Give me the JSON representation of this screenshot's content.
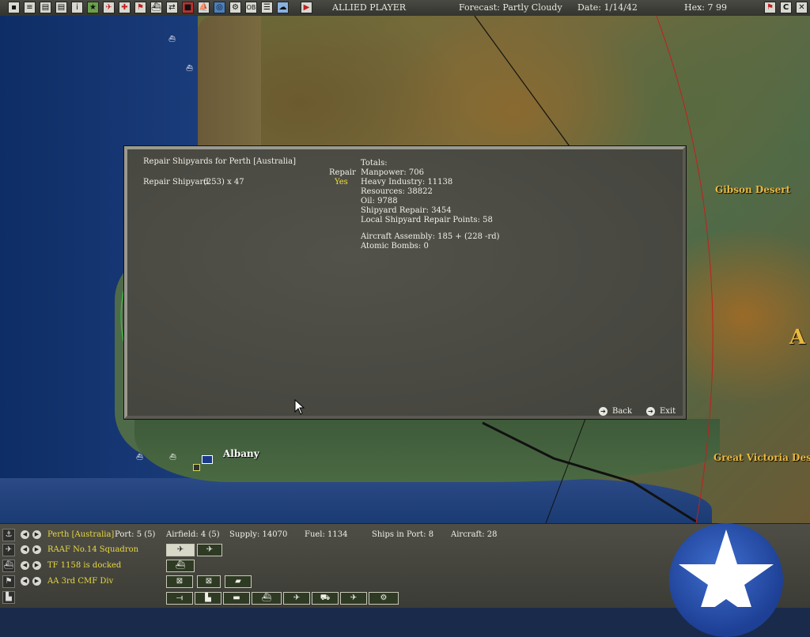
{
  "topbar": {
    "player": "ALLIED PLAYER",
    "forecast": "Forecast: Partly Cloudy",
    "date": "Date: 1/14/42",
    "hex": "Hex: 7 99",
    "buttons_left": [
      "doc",
      "doc",
      "doc",
      "doc",
      "info",
      "star",
      "plane",
      "plane",
      "flag",
      "ship",
      "ship",
      "flag",
      "ship",
      "globe",
      "sub",
      "OB",
      "list",
      "cloud",
      "play"
    ],
    "buttons_right": [
      "flag",
      "C",
      "X"
    ]
  },
  "map": {
    "places": {
      "albany": "Albany",
      "gibson": "Gibson Desert",
      "victoria": "Great Victoria Des",
      "edge_letter": "A"
    }
  },
  "dialog": {
    "title": "Repair Shipyards for Perth [Australia]",
    "item_label": "Repair Shipyard",
    "item_value": "(253) x 47",
    "repair_header": "Repair",
    "repair_value": "Yes",
    "totals_header": "Totals:",
    "totals": [
      "Manpower: 706",
      "Heavy Industry: 11138",
      "Resources: 38822",
      "Oil: 9788",
      "Shipyard Repair: 3454",
      "Local Shipyard Repair Points: 58"
    ],
    "aircraft_assembly": "Aircraft Assembly: 185 + (228 -rd)",
    "atomic_bombs": "Atomic Bombs: 0",
    "back_label": "Back",
    "exit_label": "Exit"
  },
  "bottom": {
    "base_name": "Perth [Australia]",
    "port": "Port: 5 (5)",
    "airfield": "Airfield: 4 (5)",
    "supply": "Supply: 14070",
    "fuel": "Fuel: 1134",
    "ships_in_port": "Ships in Port: 8",
    "aircraft": "Aircraft: 28",
    "air_unit": "RAAF No.14 Squadron",
    "task_force": "TF 1158 is docked",
    "ground_unit": "AA 3rd CMF Div"
  },
  "colors": {
    "base_name": "#e8d840",
    "unit_text": "#e8d840",
    "stat_text": "#f0f0e8",
    "place_label": "#e8b840",
    "emblem": "#1d3f94"
  }
}
